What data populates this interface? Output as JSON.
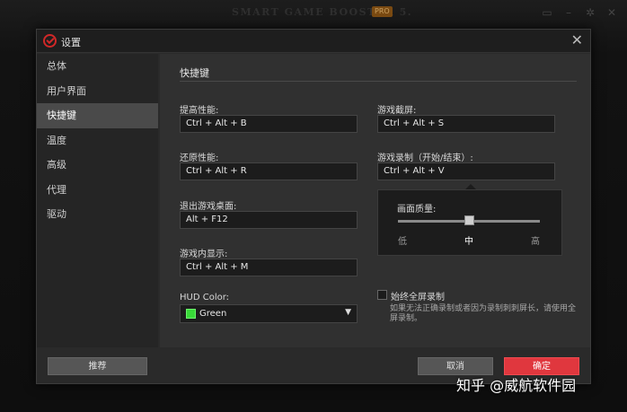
{
  "background_app": {
    "title": "SMART GAME BOOSTER 5.",
    "badge": "PRO",
    "icons": [
      "monitor-icon",
      "minimize-icon",
      "gear-icon",
      "close-icon"
    ]
  },
  "dialog": {
    "title": "设置",
    "close_glyph": "✕"
  },
  "sidebar": {
    "items": [
      {
        "label": "总体",
        "active": false
      },
      {
        "label": "用户界面",
        "active": false
      },
      {
        "label": "快捷键",
        "active": true
      },
      {
        "label": "温度",
        "active": false
      },
      {
        "label": "高级",
        "active": false
      },
      {
        "label": "代理",
        "active": false
      },
      {
        "label": "驱动",
        "active": false
      }
    ]
  },
  "content": {
    "section_title": "快捷键",
    "left_fields": [
      {
        "label": "提高性能:",
        "value": "Ctrl + Alt + B"
      },
      {
        "label": "还原性能:",
        "value": "Ctrl + Alt + R"
      },
      {
        "label": "退出游戏桌面:",
        "value": "Alt + F12"
      },
      {
        "label": "游戏内显示:",
        "value": "Ctrl + Alt + M"
      }
    ],
    "hud_color": {
      "label": "HUD Color:",
      "value": "Green",
      "swatch_color": "#38d838"
    },
    "right_fields": [
      {
        "label": "游戏截屏:",
        "value": "Ctrl + Alt + S"
      },
      {
        "label": "游戏录制（开始/结束）:",
        "value": "Ctrl + Alt + V"
      }
    ],
    "quality": {
      "label": "画面质量:",
      "low": "低",
      "mid": "中",
      "high": "高",
      "level": 0.5
    },
    "fullscreen_record": {
      "label": "始终全屏录制",
      "checked": false
    },
    "hint": "如果无法正确录制或者因为录制刺刺屏长，请使用全屏录制。"
  },
  "footer": {
    "reset_label": "推荐",
    "cancel_label": "取消",
    "ok_label": "确定"
  },
  "watermark": "知乎 @威航软件园",
  "colors": {
    "accent_red": "#e0373e",
    "sidebar_active": "#4a4a4a",
    "panel_bg": "#303030"
  }
}
